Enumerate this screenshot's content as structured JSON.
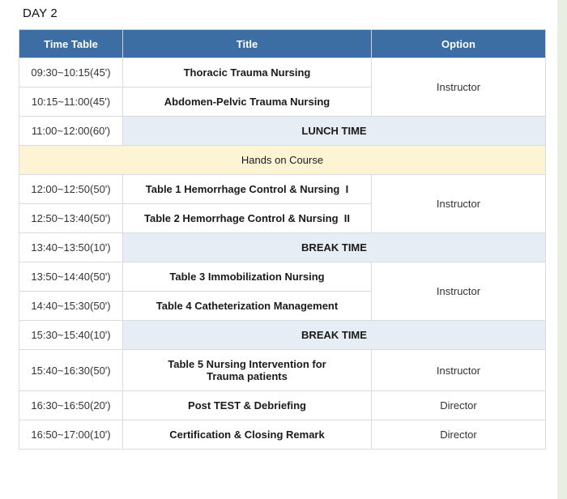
{
  "day_label": "DAY 2",
  "headers": {
    "time": "Time Table",
    "title": "Title",
    "option": "Option"
  },
  "rows": [
    {
      "time": "09:30~10:15(45')",
      "title": "Thoracic Trauma Nursing",
      "option": "Instructor"
    },
    {
      "time": "10:15~11:00(45')",
      "title": "Abdomen-Pelvic Trauma Nursing"
    },
    {
      "time": "11:00~12:00(60')",
      "title": "LUNCH TIME"
    },
    {
      "section": "Hands on Course"
    },
    {
      "time": "12:00~12:50(50')",
      "title": "Table 1 Hemorrhage Control & Nursing  I",
      "option": "Instructor"
    },
    {
      "time": "12:50~13:40(50')",
      "title": "Table 2 Hemorrhage Control & Nursing  II"
    },
    {
      "time": "13:40~13:50(10')",
      "title": "BREAK TIME"
    },
    {
      "time": "13:50~14:40(50')",
      "title": "Table 3 Immobilization Nursing",
      "option": "Instructor"
    },
    {
      "time": "14:40~15:30(50')",
      "title": "Table 4 Catheterization Management"
    },
    {
      "time": "15:30~15:40(10')",
      "title": "BREAK TIME"
    },
    {
      "time": "15:40~16:30(50')",
      "title": "Table 5 Nursing Intervention for Trauma patients",
      "option": "Instructor"
    },
    {
      "time": "16:30~16:50(20')",
      "title": "Post TEST & Debriefing",
      "option": "Director"
    },
    {
      "time": "16:50~17:00(10')",
      "title": "Certification & Closing Remark",
      "option": "Director"
    }
  ]
}
